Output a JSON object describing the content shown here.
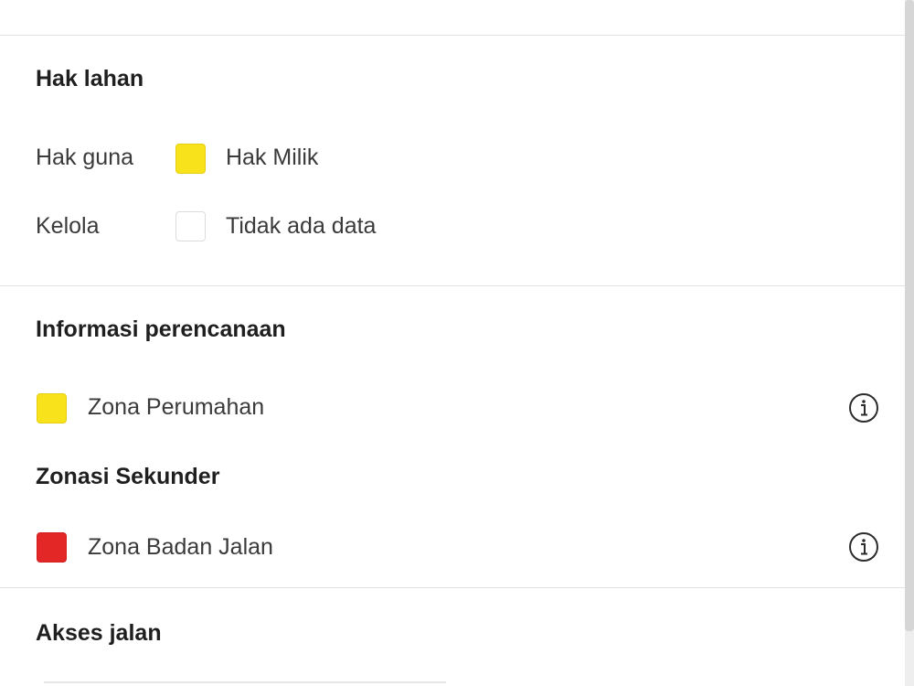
{
  "land_rights": {
    "title": "Hak lahan",
    "rows": [
      {
        "type_label": "Hak guna",
        "legend_label": "Hak Milik",
        "color": "#F7E21B"
      },
      {
        "type_label": "Kelola",
        "legend_label": "Tidak ada data",
        "color": "#FFFFFF"
      }
    ]
  },
  "planning": {
    "title": "Informasi perencanaan",
    "primary_zone": {
      "label": "Zona Perumahan",
      "color": "#F7E21B",
      "icon": "info-icon"
    },
    "secondary_title": "Zonasi Sekunder",
    "secondary_zone": {
      "label": "Zona Badan Jalan",
      "color": "#E32626",
      "icon": "info-icon"
    }
  },
  "road_access": {
    "title": "Akses jalan"
  }
}
